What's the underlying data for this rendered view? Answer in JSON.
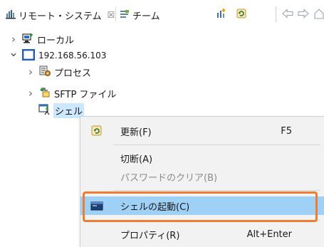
{
  "tabs": {
    "remote": {
      "label": "リモート・システム",
      "close": "☒",
      "icon": "remote-systems-icon"
    },
    "team": {
      "label": "チーム",
      "icon": "team-icon"
    }
  },
  "toolbar": {
    "buttons": [
      {
        "name": "new-connection-icon"
      },
      {
        "name": "refresh-icon"
      },
      {
        "name": "back-arrow-icon"
      },
      {
        "name": "forward-arrow-icon"
      },
      {
        "name": "home-icon"
      }
    ]
  },
  "tree": {
    "local": {
      "label": "ローカル",
      "chevron": "›"
    },
    "host": {
      "label": "192.168.56.103",
      "chevron": "⌄"
    },
    "processes": {
      "label": "プロセス",
      "chevron": "›"
    },
    "sftp": {
      "label": "SFTP ファイル",
      "chevron": "›"
    },
    "shells": {
      "label": "シェル"
    }
  },
  "context_menu": {
    "items": [
      {
        "id": "refresh",
        "label": "更新(F)",
        "accel": "F5",
        "enabled": true
      },
      {
        "id": "disconnect",
        "label": "切断(A)",
        "accel": "",
        "enabled": true
      },
      {
        "id": "clear-password",
        "label": "パスワードのクリア(B)",
        "accel": "",
        "enabled": false
      },
      {
        "id": "launch-shell",
        "label": "シェルの起動(C)",
        "accel": "",
        "enabled": true,
        "highlighted": true
      },
      {
        "id": "properties",
        "label": "プロパティ(R)",
        "accel": "Alt+Enter",
        "enabled": true
      }
    ]
  },
  "colors": {
    "selection": "#cce8ff",
    "menu_highlight": "#9fd0f5",
    "annotation_box": "#ed7d31",
    "host_icon": "#1f5fbf"
  }
}
